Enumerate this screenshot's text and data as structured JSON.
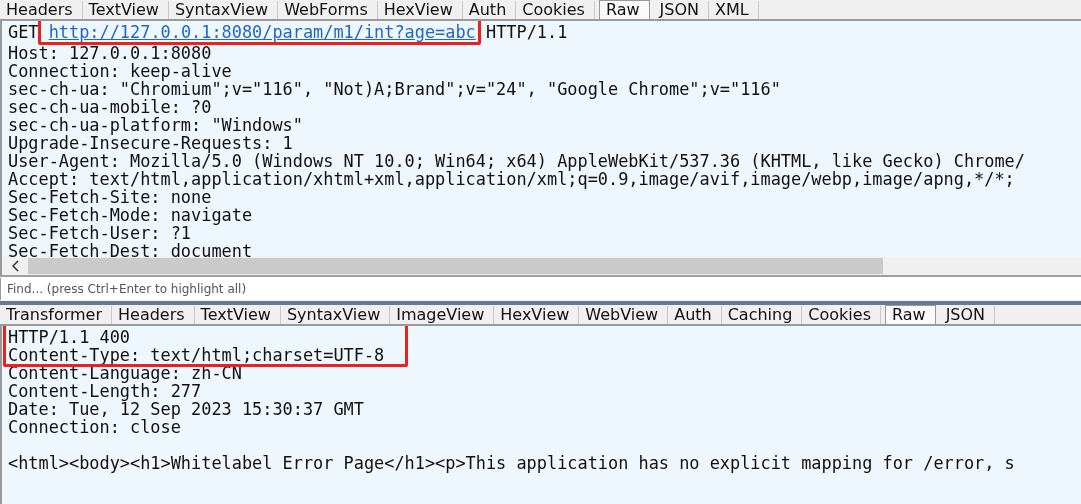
{
  "request": {
    "tabs": [
      {
        "label": "Headers",
        "selected": false
      },
      {
        "label": "TextView",
        "selected": false
      },
      {
        "label": "SyntaxView",
        "selected": false
      },
      {
        "label": "WebForms",
        "selected": false
      },
      {
        "label": "HexView",
        "selected": false
      },
      {
        "label": "Auth",
        "selected": false
      },
      {
        "label": "Cookies",
        "selected": false
      },
      {
        "label": "Raw",
        "selected": true
      },
      {
        "label": "JSON",
        "selected": false
      },
      {
        "label": "XML",
        "selected": false
      }
    ],
    "request_line": {
      "method": "GET",
      "url": "http://127.0.0.1:8080/param/m1/int?age=abc",
      "version": "HTTP/1.1",
      "highlighted": true
    },
    "lines": [
      "Host: 127.0.0.1:8080",
      "Connection: keep-alive",
      "sec-ch-ua: \"Chromium\";v=\"116\", \"Not)A;Brand\";v=\"24\", \"Google Chrome\";v=\"116\"",
      "sec-ch-ua-mobile: ?0",
      "sec-ch-ua-platform: \"Windows\"",
      "Upgrade-Insecure-Requests: 1",
      "User-Agent: Mozilla/5.0 (Windows NT 10.0; Win64; x64) AppleWebKit/537.36 (KHTML, like Gecko) Chrome/",
      "Accept: text/html,application/xhtml+xml,application/xml;q=0.9,image/avif,image/webp,image/apng,*/*;",
      "Sec-Fetch-Site: none",
      "Sec-Fetch-Mode: navigate",
      "Sec-Fetch-User: ?1",
      "Sec-Fetch-Dest: document"
    ]
  },
  "find": {
    "placeholder": "Find... (press Ctrl+Enter to highlight all)"
  },
  "response": {
    "tabs": [
      {
        "label": "Transformer",
        "selected": false
      },
      {
        "label": "Headers",
        "selected": false
      },
      {
        "label": "TextView",
        "selected": false
      },
      {
        "label": "SyntaxView",
        "selected": false
      },
      {
        "label": "ImageView",
        "selected": false
      },
      {
        "label": "HexView",
        "selected": false
      },
      {
        "label": "WebView",
        "selected": false
      },
      {
        "label": "Auth",
        "selected": false
      },
      {
        "label": "Caching",
        "selected": false
      },
      {
        "label": "Cookies",
        "selected": false
      },
      {
        "label": "Raw",
        "selected": true
      },
      {
        "label": "JSON",
        "selected": false
      }
    ],
    "lines": [
      {
        "text": "HTTP/1.1 400",
        "highlighted": true
      },
      {
        "text": "Content-Type: text/html;charset=UTF-8",
        "highlighted": true
      },
      {
        "text": "Content-Language: zh-CN",
        "highlighted": false
      },
      {
        "text": "Content-Length: 277",
        "highlighted": false
      },
      {
        "text": "Date: Tue, 12 Sep 2023 15:30:37 GMT",
        "highlighted": false
      },
      {
        "text": "Connection: close",
        "highlighted": false,
        "blank_after": true
      },
      {
        "text": "<html><body><h1>Whitelabel Error Page</h1><p>This application has no explicit mapping for /error, s",
        "highlighted": false
      }
    ]
  }
}
